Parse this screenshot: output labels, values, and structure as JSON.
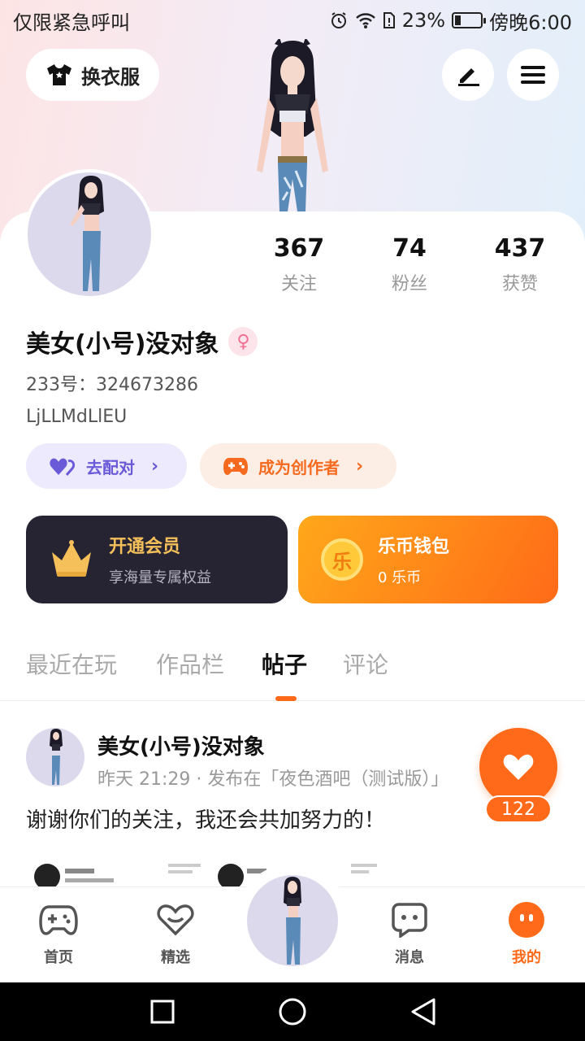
{
  "status_bar": {
    "carrier": "仅限紧急呼叫",
    "battery": "23%",
    "time": "傍晚6:00",
    "battery_level": 0.23
  },
  "header": {
    "outfit_label": "换衣服",
    "edit_icon": "pen-icon",
    "menu_icon": "hamburger-icon"
  },
  "stats": [
    {
      "value": "367",
      "label": "关注"
    },
    {
      "value": "74",
      "label": "粉丝"
    },
    {
      "value": "437",
      "label": "获赞"
    }
  ],
  "profile": {
    "name": "美女(小号)没对象",
    "gender_icon": "female-icon",
    "uid": "233号：324673286",
    "bio": "LjLLMdLlEU"
  },
  "actions": {
    "match_label": "去配对",
    "creator_label": "成为创作者"
  },
  "promos": {
    "vip_title": "开通会员",
    "vip_sub": "享海量专属权益",
    "wallet_title": "乐币钱包",
    "wallet_sub": "0 乐币",
    "wallet_coin_char": "乐"
  },
  "tabs": [
    {
      "label": "最近在玩",
      "active": false
    },
    {
      "label": "作品栏",
      "active": false
    },
    {
      "label": "帖子",
      "active": true
    },
    {
      "label": "评论",
      "active": false
    }
  ],
  "post": {
    "author": "美女(小号)没对象",
    "meta": "昨天 21:29 · 发布在「夜色酒吧（测试版）」",
    "text": "谢谢你们的关注，我还会共加努力的！",
    "likes": "122"
  },
  "bottom_nav": [
    {
      "label": "首页",
      "icon": "gamepad-icon",
      "active": false
    },
    {
      "label": "精选",
      "icon": "heart-chat-icon",
      "active": false
    },
    {
      "label": "消息",
      "icon": "message-icon",
      "active": false
    },
    {
      "label": "我的",
      "icon": "profile-dots-icon",
      "active": true
    }
  ],
  "colors": {
    "accent": "#ff6a1a",
    "purple": "#6a59d9",
    "vip_dark": "#262433"
  }
}
